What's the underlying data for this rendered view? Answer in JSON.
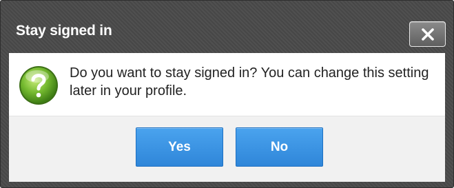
{
  "dialog": {
    "title": "Stay signed in",
    "message": "Do you want to stay signed in? You can change this setting later in your profile.",
    "close_icon": "close-icon",
    "question_icon": "question-mark-icon",
    "buttons": {
      "yes_label": "Yes",
      "no_label": "No"
    }
  },
  "colors": {
    "titlebar": "#4a4a4a",
    "button_primary": "#3a95e4",
    "icon_green": "#6ab52d"
  }
}
